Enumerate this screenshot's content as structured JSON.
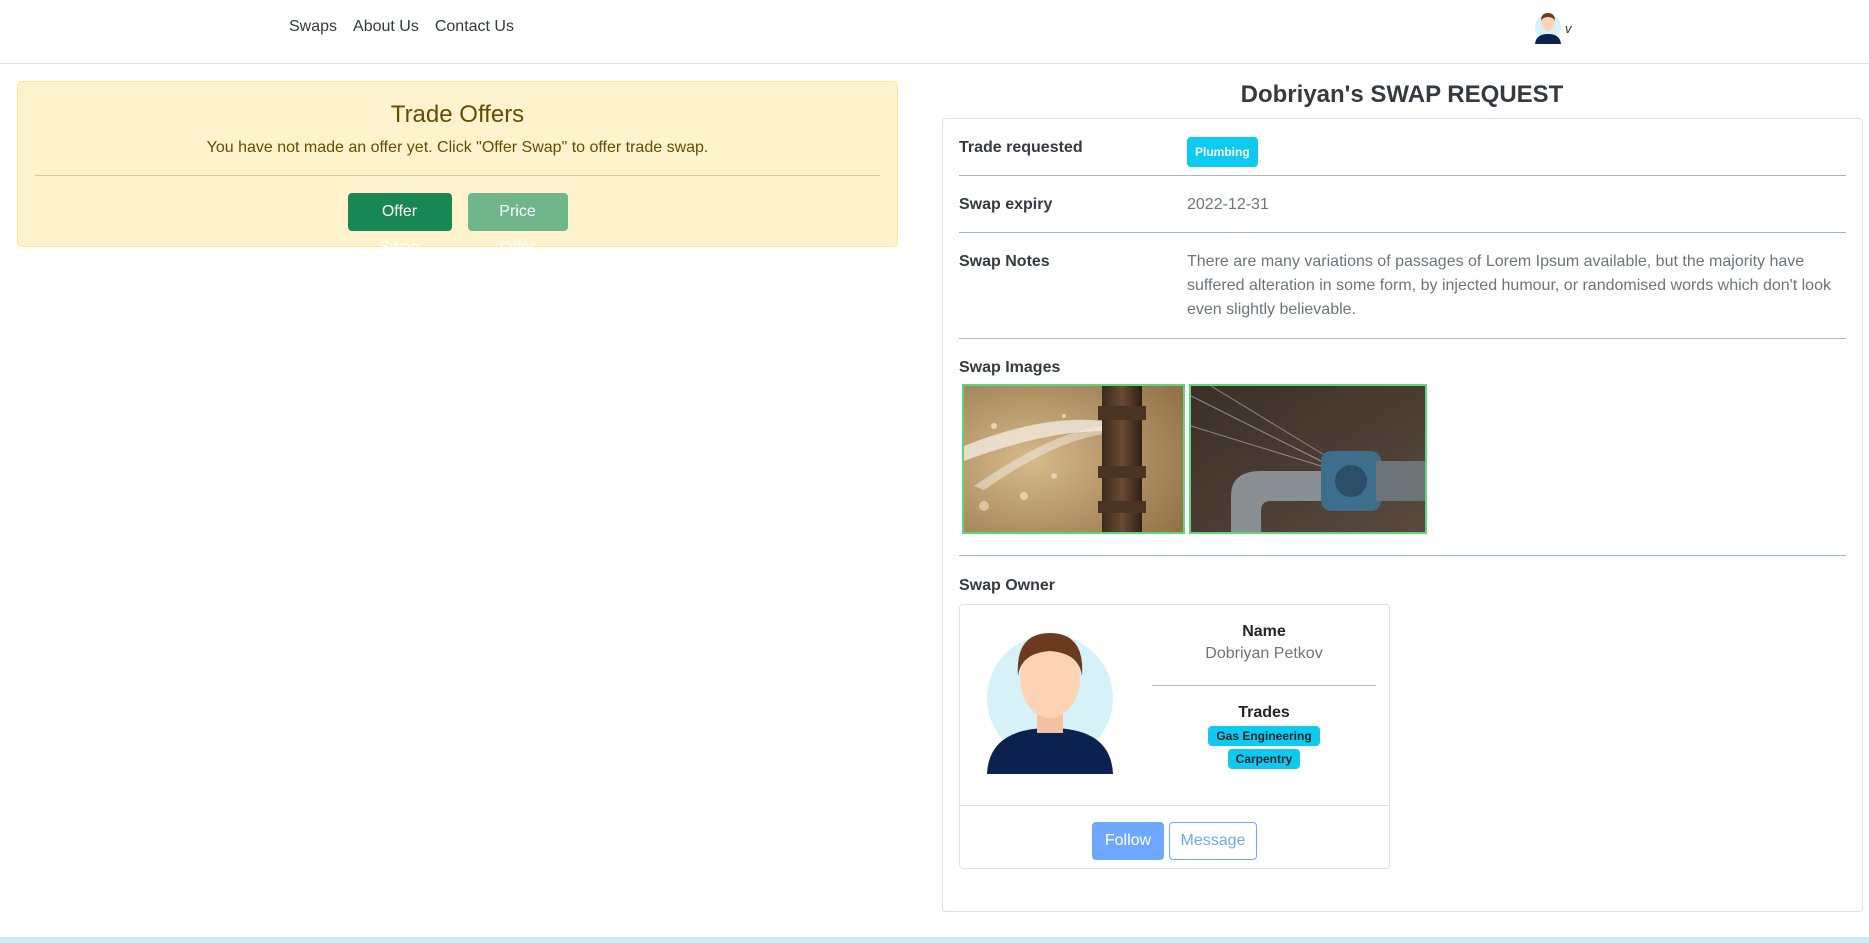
{
  "nav": {
    "links": [
      "Swaps",
      "About Us",
      "Contact Us"
    ],
    "user_caret": "v"
  },
  "offers": {
    "title": "Trade Offers",
    "message": "You have not made an offer yet. Click \"Offer Swap\" to offer trade swap.",
    "offer_swap_label": "Offer Swap",
    "price_offer_label": "Price Offer"
  },
  "request": {
    "title": "Dobriyan's SWAP REQUEST",
    "trade_requested_label": "Trade requested",
    "trade_requested_badge": "Plumbing",
    "expiry_label": "Swap expiry",
    "expiry_value": "2022-12-31",
    "notes_label": "Swap Notes",
    "notes_value": "There are many variations of passages of Lorem Ipsum available, but the majority have suffered alteration in some form, by injected humour, or randomised words which don't look even slightly believable.",
    "images_label": "Swap Images",
    "owner_label": "Swap Owner"
  },
  "owner": {
    "name_heading": "Name",
    "name": "Dobriyan Petkov",
    "trades_heading": "Trades",
    "trades": [
      "Gas Engineering",
      "Carpentry"
    ],
    "follow_label": "Follow",
    "message_label": "Message"
  },
  "colors": {
    "success": "#198754",
    "alert_bg": "#fff3cd",
    "badge": "#0dcaf0",
    "primary": "#6ea8fe"
  }
}
